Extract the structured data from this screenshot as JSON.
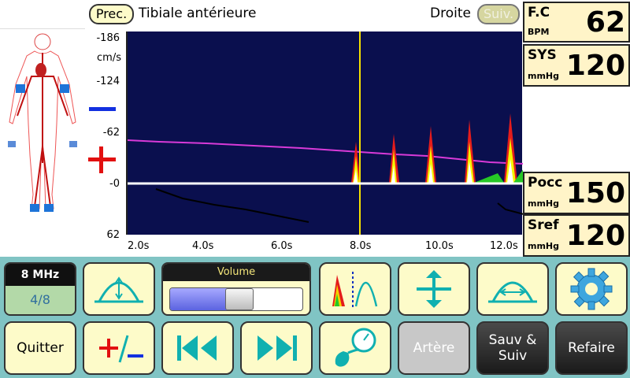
{
  "header": {
    "prev_label": "Prec.",
    "title": "Tibiale antérieure",
    "side": "Droite",
    "next_label": "Suiv."
  },
  "axis": {
    "unit": "cm/s",
    "y_ticks": [
      "-186",
      "-124",
      "-62",
      "-0",
      "62"
    ],
    "x_ticks": [
      "2.0s",
      "4.0s",
      "6.0s",
      "8.0s",
      "10.0s",
      "12.0s"
    ]
  },
  "vitals": {
    "fc": {
      "label": "F.C",
      "unit": "BPM",
      "value": "62"
    },
    "sys": {
      "label": "SYS",
      "unit": "mmHg",
      "value": "120"
    },
    "pocc": {
      "label": "Pocc",
      "unit": "mmHg",
      "value": "150"
    },
    "sref": {
      "label": "Sref",
      "unit": "mmHg",
      "value": "120"
    }
  },
  "probe": {
    "frequency": "8 MHz",
    "gain_step": "4/8"
  },
  "volume": {
    "label": "Volume",
    "level": 0.52
  },
  "buttons": {
    "quit": "Quitter",
    "artery": "Artère",
    "save_next": "Sauv & Suiv",
    "redo": "Refaire"
  },
  "colors": {
    "spectrum_bg": "#0a0f4e",
    "baseline_curve": "#d83ad8",
    "cursor": "#f5e200",
    "panel_bg": "#80c4c4",
    "button_bg": "#fdfbc9",
    "value_bg": "#fff4c8"
  },
  "icons": {
    "spectrum_shape": "envelope-peak-icon",
    "doppler": "doppler-spectrum-icon",
    "scale": "vertical-arrows-icon",
    "width": "horizontal-arrow-icon",
    "settings": "gear-icon",
    "invert": "plus-minus-icon",
    "rewind": "rewind-icon",
    "forward": "fast-forward-icon",
    "cuff": "blood-pressure-cuff-icon"
  }
}
